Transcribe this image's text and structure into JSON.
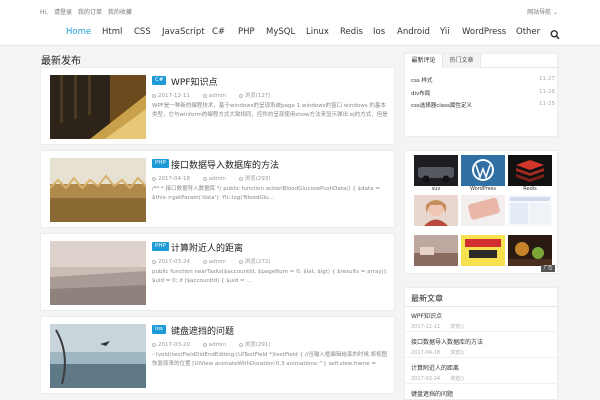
{
  "topbar": {
    "greeting": "Hi,",
    "link1": "请登录",
    "link2": "我的订单",
    "link3": "我的收藏",
    "right": "网站导航 ⌄"
  },
  "nav": {
    "items": [
      "Home",
      "Html",
      "CSS",
      "JavaScript",
      "C#",
      "PHP",
      "MySQL",
      "Linux",
      "Redis",
      "Ios",
      "Android",
      "Yii",
      "WordPress",
      "Other"
    ],
    "active": "Home",
    "search_icon": "search-icon"
  },
  "section_title": "最新发布",
  "posts": [
    {
      "tag": "C#",
      "title": "WPF知识点",
      "date": "2017-12-11",
      "author": "admin",
      "views": "浏览(127)",
      "excerpt": "WPF是一种新的编程技术，基于windows的呈现系统page 1 windows的窗口 windows 的基本类型，它与winform的编程方式大致相同，控件的呈现使用show方法来显示弹出 ej的方式，但是Main的Login窗口..."
    },
    {
      "tag": "PHP",
      "title": "接口数据导入数据库的方法",
      "date": "2017-04-18",
      "author": "admin",
      "views": "浏览(293)",
      "excerpt": "/** * 接口数据导入数据库 */ public function actionBloodGlucosePushData() { $data = $this->getParam('data'); Yii::log('BloodGlu..."
    },
    {
      "tag": "PHP",
      "title": "计算附近人的距离",
      "date": "2017-03-24",
      "author": "admin",
      "views": "浏览(272)",
      "excerpt": "public function nearTasks($accountId, $pageNum = 0, $lat, $lgt) { $results = array(); $uid = 0; if ($accountId) { $uid = ..."
    },
    {
      "tag": "Ios",
      "title": "键盘遮挡的问题",
      "date": "2017-03-20",
      "author": "admin",
      "views": "浏览(291)",
      "excerpt": "- (void)textFieldDidEndEditing:(UITextField *)textField { //当输入框编辑结束的时候,将视图恢复原来的位置 [UIView animateWithDuration:0.3 animations:^{ self.view.frame = CGRectMake(0,..."
    }
  ],
  "sidebar_tabs": {
    "tabs": [
      "最新评论",
      "热门文章"
    ],
    "rows": [
      {
        "text": "css 样式",
        "date": "11-27"
      },
      {
        "text": "div布局",
        "date": "11-26"
      },
      {
        "text": "css选择器class属性定义",
        "date": "11-25"
      }
    ]
  },
  "gallery": {
    "items": [
      {
        "caption": "suv"
      },
      {
        "caption": "WordPress"
      },
      {
        "caption": "Redis"
      },
      {
        "caption": ""
      },
      {
        "caption": ""
      },
      {
        "caption": ""
      },
      {
        "caption": ""
      },
      {
        "caption": ""
      },
      {
        "caption": ""
      }
    ],
    "tag_label": "广告"
  },
  "latest": {
    "head": "最新文章",
    "items": [
      {
        "title": "WPF知识点",
        "date": "2017-12-11",
        "views": "浏览()"
      },
      {
        "title": "接口数据导入数据库的方法",
        "date": "2017-04-18",
        "views": "浏览()"
      },
      {
        "title": "计算附近人的距离",
        "date": "2017-03-24",
        "views": "浏览()"
      },
      {
        "title": "键盘遮挡的问题",
        "date": "",
        "views": ""
      }
    ]
  },
  "colors": {
    "accent": "#1e9bd7",
    "text": "#333333",
    "muted": "#999999"
  }
}
